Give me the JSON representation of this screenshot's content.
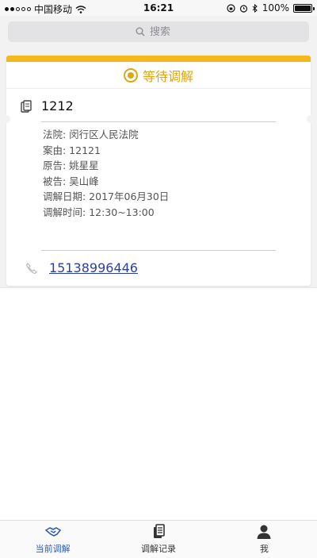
{
  "status_bar": {
    "carrier": "中国移动",
    "time": "16:21",
    "battery": "100%",
    "battery_level": 1.0
  },
  "search": {
    "placeholder": "搜索"
  },
  "card": {
    "status_label": "等待调解",
    "case_id": "1212",
    "details": [
      "法院: 闵行区人民法院",
      "案由: 12121",
      "原告: 姚星星",
      "被告: 吴山峰",
      "调解日期: 2017年06月30日",
      "调解时间: 12:30~13:00"
    ],
    "phone": "15138996446"
  },
  "tabs": [
    {
      "label": "当前调解",
      "icon": "handshake-icon",
      "active": true
    },
    {
      "label": "调解记录",
      "icon": "documents-icon",
      "active": false
    },
    {
      "label": "我",
      "icon": "person-icon",
      "active": false
    }
  ],
  "colors": {
    "accent": "#f5b81f",
    "active_tab": "#2c5cb8",
    "link": "#2c3fa8"
  }
}
